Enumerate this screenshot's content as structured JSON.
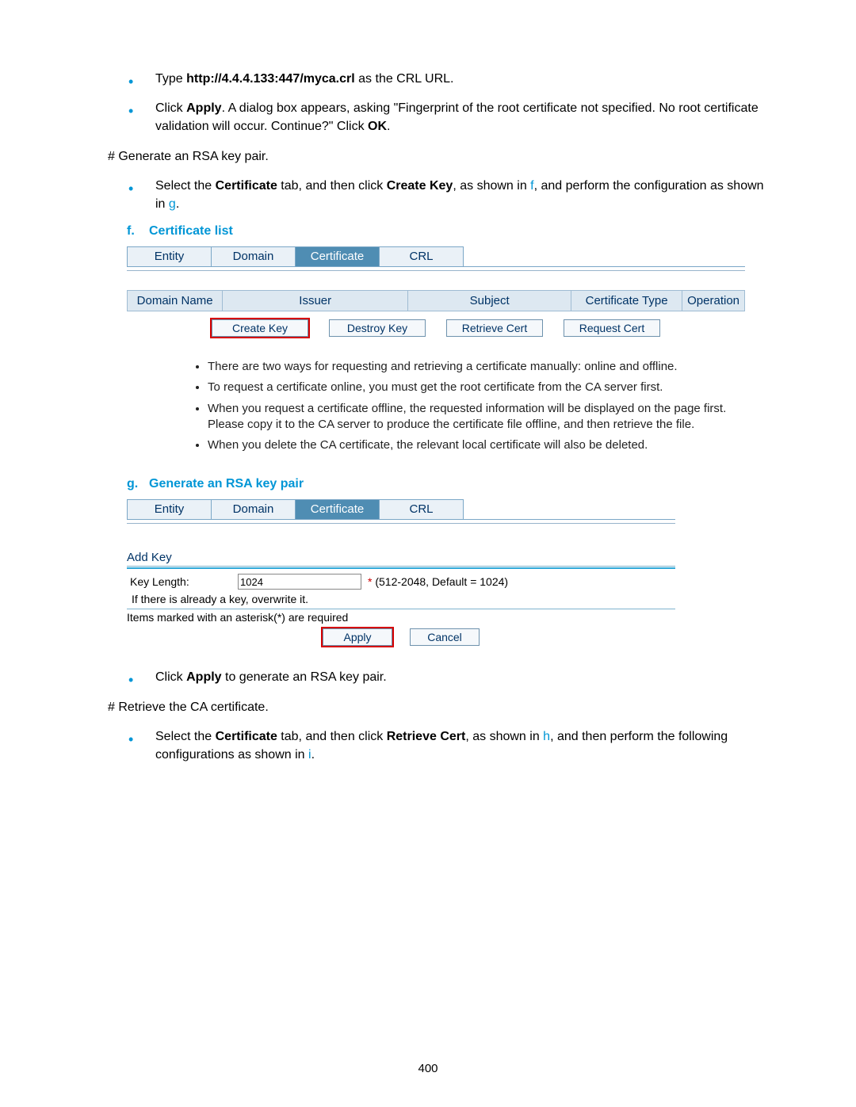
{
  "bullets_top": [
    {
      "pre": "Type ",
      "bold": "http://4.4.4.133:447/myca.crl",
      "post": " as the CRL URL."
    },
    {
      "pre": "Click ",
      "bold": "Apply",
      "post": ". A dialog box appears, asking \"Fingerprint of the root certificate not specified. No root certificate validation will occur. Continue?\" Click ",
      "bold2": "OK",
      "post2": "."
    }
  ],
  "hash1": "# Generate an RSA key pair.",
  "bullet_select_cert": {
    "pre": "Select the ",
    "b1": "Certificate",
    "mid": " tab, and then click ",
    "b2": "Create Key",
    "post": ", as shown in ",
    "ref1": "f",
    "post2": ", and perform the configuration as shown in ",
    "ref2": "g",
    "post3": "."
  },
  "cap_f": {
    "letter": "f.",
    "title": "Certificate list"
  },
  "tabs": [
    "Entity",
    "Domain",
    "Certificate",
    "CRL"
  ],
  "cert_headers": [
    "Domain Name",
    "Issuer",
    "Subject",
    "Certificate Type",
    "Operation"
  ],
  "cert_buttons": [
    "Create Key",
    "Destroy Key",
    "Retrieve Cert",
    "Request Cert"
  ],
  "notes": [
    "There are two ways for requesting and retrieving a certificate manually: online and offline.",
    "To request a certificate online, you must get the root certificate from the CA server first.",
    "When you request a certificate offline, the requested information will be displayed on the page first. Please copy it to the CA server to produce the certificate file offline, and then retrieve the file.",
    "When you delete the CA certificate, the relevant local certificate will also be deleted."
  ],
  "cap_g": {
    "letter": "g.",
    "title": "Generate an RSA key pair"
  },
  "addkey": {
    "title": "Add Key",
    "label": "Key Length:",
    "value": "1024",
    "hint": "(512-2048, Default = 1024)",
    "overwrite": "If there is already a key, overwrite it.",
    "required": "Items marked with an asterisk(*) are required",
    "apply": "Apply",
    "cancel": "Cancel"
  },
  "bullet_apply": {
    "pre": "Click ",
    "bold": "Apply",
    "post": " to generate an RSA key pair."
  },
  "hash2": "# Retrieve the CA certificate.",
  "bullet_retrieve": {
    "pre": "Select the ",
    "b1": "Certificate",
    "mid": " tab, and then click ",
    "b2": "Retrieve Cert",
    "post": ", as shown in ",
    "ref1": "h",
    "post2": ", and then perform the following configurations as shown in ",
    "ref2": "i",
    "post3": "."
  },
  "page_number": "400"
}
